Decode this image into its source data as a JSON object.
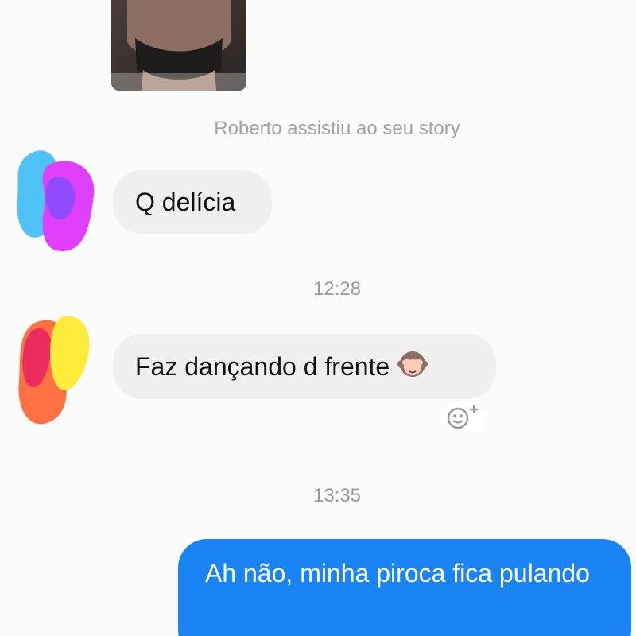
{
  "story": {
    "seen_note": "Roberto assistiu ao seu story"
  },
  "messages": [
    {
      "direction": "incoming",
      "text": "Q delícia"
    },
    {
      "timestamp": "12:28"
    },
    {
      "direction": "incoming",
      "text": "Faz dançando d frente",
      "emoji": "monkey-see-no-evil-icon"
    },
    {
      "timestamp": "13:35"
    },
    {
      "direction": "outgoing",
      "text": "Ah não, minha piroca fica pulando"
    }
  ],
  "colors": {
    "outgoing_bubble": "#1a84f5",
    "incoming_bubble": "#efefef",
    "meta_text": "#a3a3a3"
  },
  "icons": [
    "add-reaction-icon",
    "monkey-see-no-evil-icon"
  ]
}
